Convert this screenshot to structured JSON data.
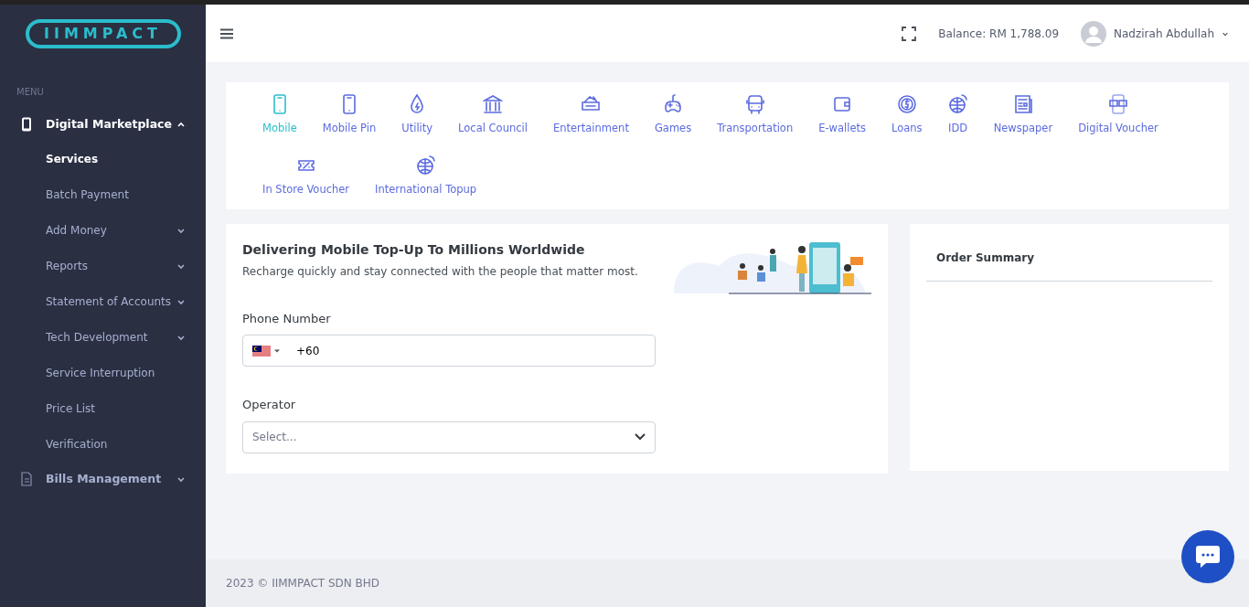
{
  "logo": {
    "text": "IIMMPACT"
  },
  "sidebar": {
    "heading": "MENU",
    "items": [
      {
        "label": "Digital Marketplace",
        "expanded": true,
        "children": [
          {
            "label": "Services",
            "selected": true
          },
          {
            "label": "Batch Payment",
            "selected": false
          },
          {
            "label": "Add Money",
            "selected": false,
            "expanded": false
          },
          {
            "label": "Reports",
            "selected": false,
            "expanded": false
          },
          {
            "label": "Statement of Accounts",
            "selected": false,
            "expanded": false
          },
          {
            "label": "Tech Development",
            "selected": false,
            "expanded": false
          },
          {
            "label": "Service Interruption",
            "selected": false
          },
          {
            "label": "Price List",
            "selected": false
          },
          {
            "label": "Verification",
            "selected": false
          }
        ]
      },
      {
        "label": "Bills Management",
        "expanded": false
      }
    ]
  },
  "topbar": {
    "balance": "Balance: RM 1,788.09",
    "user": "Nadzirah Abdullah"
  },
  "services": [
    {
      "label": "Mobile",
      "selected": true
    },
    {
      "label": "Mobile Pin",
      "selected": false
    },
    {
      "label": "Utility",
      "selected": false
    },
    {
      "label": "Local Council",
      "selected": false
    },
    {
      "label": "Entertainment",
      "selected": false
    },
    {
      "label": "Games",
      "selected": false
    },
    {
      "label": "Transportation",
      "selected": false
    },
    {
      "label": "E-wallets",
      "selected": false
    },
    {
      "label": "Loans",
      "selected": false
    },
    {
      "label": "IDD",
      "selected": false
    },
    {
      "label": "Newspaper",
      "selected": false
    },
    {
      "label": "Digital Voucher",
      "selected": false
    },
    {
      "label": "In Store Voucher",
      "selected": false
    },
    {
      "label": "International Topup",
      "selected": false
    }
  ],
  "form": {
    "title": "Delivering Mobile Top-Up To Millions Worldwide",
    "subtitle": "Recharge quickly and stay connected with the people that matter most.",
    "phone_label": "Phone Number",
    "phone_value": "+60",
    "operator_label": "Operator",
    "operator_placeholder": "Select..."
  },
  "order_summary": {
    "title": "Order Summary"
  },
  "footer": "2023 © IIMMPACT SDN BHD"
}
